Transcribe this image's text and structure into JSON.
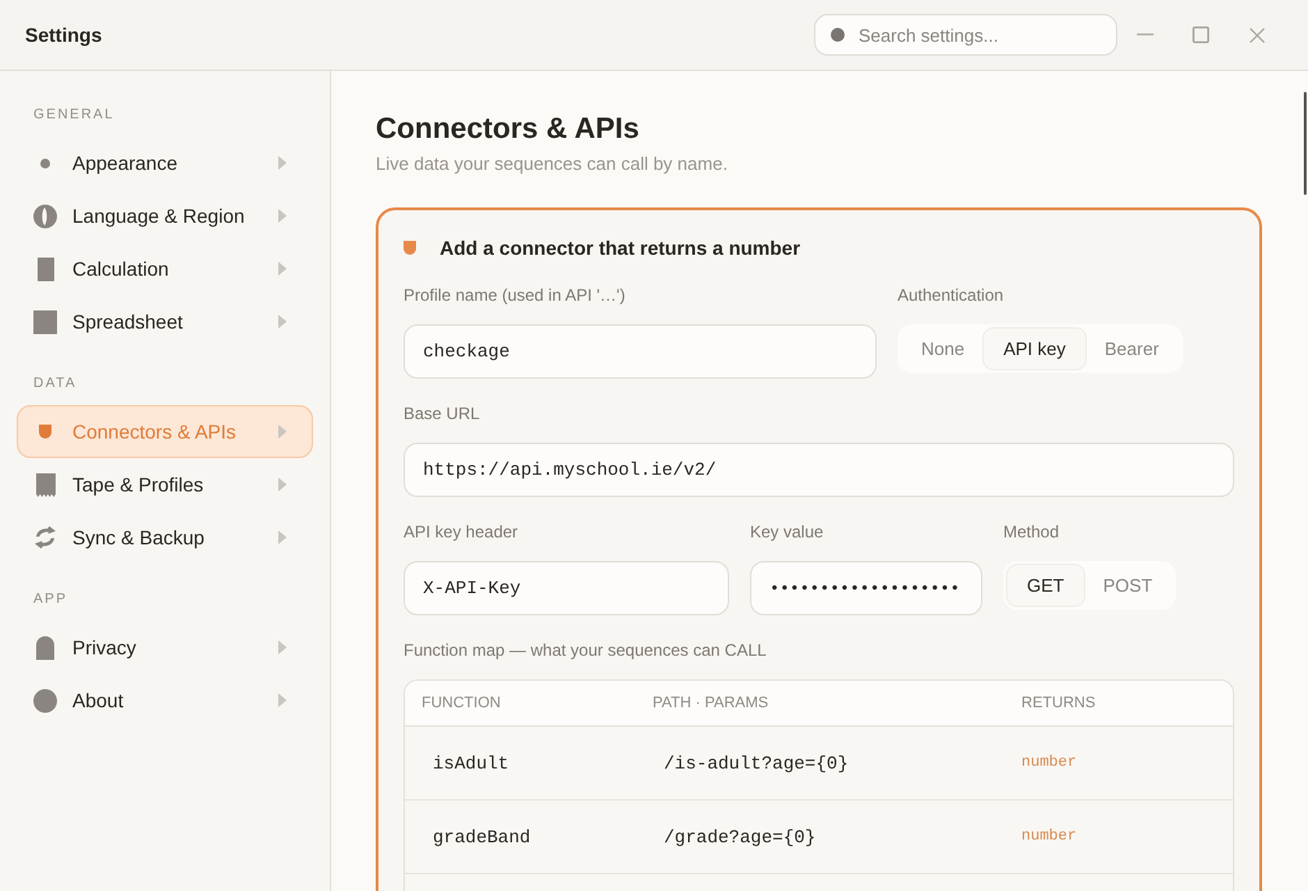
{
  "window": {
    "title": "Settings"
  },
  "search": {
    "placeholder": "Search settings..."
  },
  "sidebar": {
    "sections": [
      {
        "label": "GENERAL",
        "items": [
          {
            "label": "Appearance",
            "selected": false
          },
          {
            "label": "Language & Region",
            "selected": false
          },
          {
            "label": "Calculation",
            "selected": false
          },
          {
            "label": "Spreadsheet",
            "selected": false
          }
        ]
      },
      {
        "label": "DATA",
        "items": [
          {
            "label": "Connectors & APIs",
            "selected": true
          },
          {
            "label": "Tape & Profiles",
            "selected": false
          },
          {
            "label": "Sync & Backup",
            "selected": false
          }
        ]
      },
      {
        "label": "APP",
        "items": [
          {
            "label": "Privacy",
            "selected": false
          },
          {
            "label": "About",
            "selected": false
          }
        ]
      }
    ]
  },
  "page": {
    "title": "Connectors & APIs",
    "subtitle": "Live data your sequences can call by name."
  },
  "card": {
    "title": "Add a connector that returns a number",
    "profile_name": {
      "label": "Profile name (used in API '…')",
      "value": "checkage"
    },
    "authentication": {
      "label": "Authentication",
      "options": [
        {
          "label": "None",
          "selected": false
        },
        {
          "label": "API key",
          "selected": true
        },
        {
          "label": "Bearer",
          "selected": false
        }
      ]
    },
    "base_url": {
      "label": "Base URL",
      "value": "https://api.myschool.ie/v2/"
    },
    "api_key_header": {
      "label": "API key header",
      "value": "X-API-Key"
    },
    "key_value": {
      "label": "Key value",
      "value": "•••••••••••••••••••"
    },
    "method": {
      "label": "Method",
      "options": [
        {
          "label": "GET",
          "selected": true
        },
        {
          "label": "POST",
          "selected": false
        }
      ]
    },
    "function_map": {
      "label": "Function map — what your sequences can CALL",
      "columns": [
        "FUNCTION",
        "PATH · PARAMS",
        "RETURNS"
      ],
      "rows": [
        {
          "function": "isAdult",
          "path": "/is-adult?age={0}",
          "returns": "number"
        },
        {
          "function": "gradeBand",
          "path": "/grade?age={0}",
          "returns": "number"
        }
      ]
    }
  }
}
